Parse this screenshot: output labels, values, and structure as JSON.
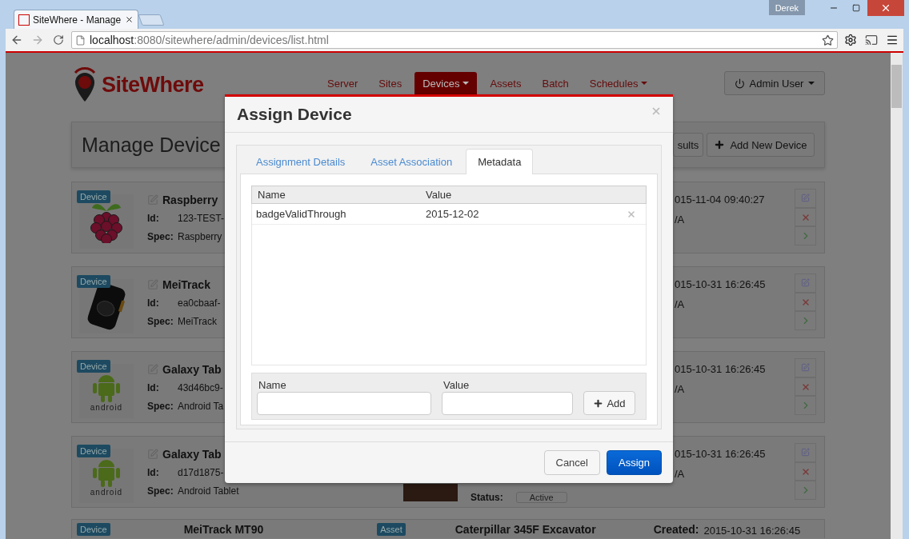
{
  "browser": {
    "tab_title": "SiteWhere - Manage",
    "user_badge": "Derek",
    "url_host": "localhost",
    "url_path": ":8080/sitewhere/admin/devices/list.html"
  },
  "header": {
    "logo": "SiteWhere",
    "nav": [
      {
        "label": "Server",
        "selected": false,
        "dropdown": false
      },
      {
        "label": "Sites",
        "selected": false,
        "dropdown": false
      },
      {
        "label": "Devices",
        "selected": true,
        "dropdown": true
      },
      {
        "label": "Assets",
        "selected": false,
        "dropdown": false
      },
      {
        "label": "Batch",
        "selected": false,
        "dropdown": false
      },
      {
        "label": "Schedules",
        "selected": false,
        "dropdown": true
      }
    ],
    "user_button": "Admin User"
  },
  "title_bar": {
    "title": "Manage Device",
    "buttons": [
      {
        "label": "sults",
        "kind": "plain"
      },
      {
        "label": "Add New Device",
        "kind": "add"
      }
    ]
  },
  "devices": [
    {
      "badge": "Device",
      "kind": "raspberry",
      "name": "Raspberry",
      "id_label": "Id:",
      "id": "123-TEST-",
      "spec_label": "Spec:",
      "spec": "Raspberry",
      "created": "015-11-04 09:40:27",
      "field_2": "/A"
    },
    {
      "badge": "Device",
      "kind": "tracker",
      "name": "MeiTrack",
      "id_label": "Id:",
      "id": "ea0cbaaf-",
      "spec_label": "Spec:",
      "spec": "MeiTrack",
      "created": "015-10-31 16:26:45",
      "field_2": "/A"
    },
    {
      "badge": "Device",
      "kind": "android",
      "image_text": "android",
      "name": "Galaxy Tab",
      "id_label": "Id:",
      "id": "43d46bc9-",
      "spec_label": "Spec:",
      "spec": "Android Ta",
      "created": "015-10-31 16:26:45",
      "field_2": "/A"
    },
    {
      "badge": "Device",
      "kind": "android",
      "image_text": "android",
      "name": "Galaxy Tab",
      "id_label": "Id:",
      "id": "d17d1875-",
      "spec_label": "Spec:",
      "spec": "Android Tablet",
      "status_label": "Status:",
      "status": "Active",
      "created": "015-10-31 16:26:45",
      "field_2": "/A"
    }
  ],
  "partial_row": {
    "badge": "Device",
    "name": "MeiTrack MT90",
    "asset_badge": "Asset",
    "asset_name": "Caterpillar 345F Excavator",
    "created_label": "Created:",
    "created": "2015-10-31 16:26:45"
  },
  "modal": {
    "title": "Assign Device",
    "tabs": [
      {
        "label": "Assignment Details",
        "selected": false
      },
      {
        "label": "Asset Association",
        "selected": false
      },
      {
        "label": "Metadata",
        "selected": true
      }
    ],
    "table": {
      "columns": [
        "Name",
        "Value"
      ],
      "rows": [
        {
          "name": "badgeValidThrough",
          "value": "2015-12-02"
        }
      ]
    },
    "form": {
      "name_label": "Name",
      "value_label": "Value",
      "add_button": "Add"
    },
    "buttons": [
      {
        "label": "Cancel",
        "kind": "default"
      },
      {
        "label": "Assign",
        "kind": "primary"
      }
    ]
  }
}
